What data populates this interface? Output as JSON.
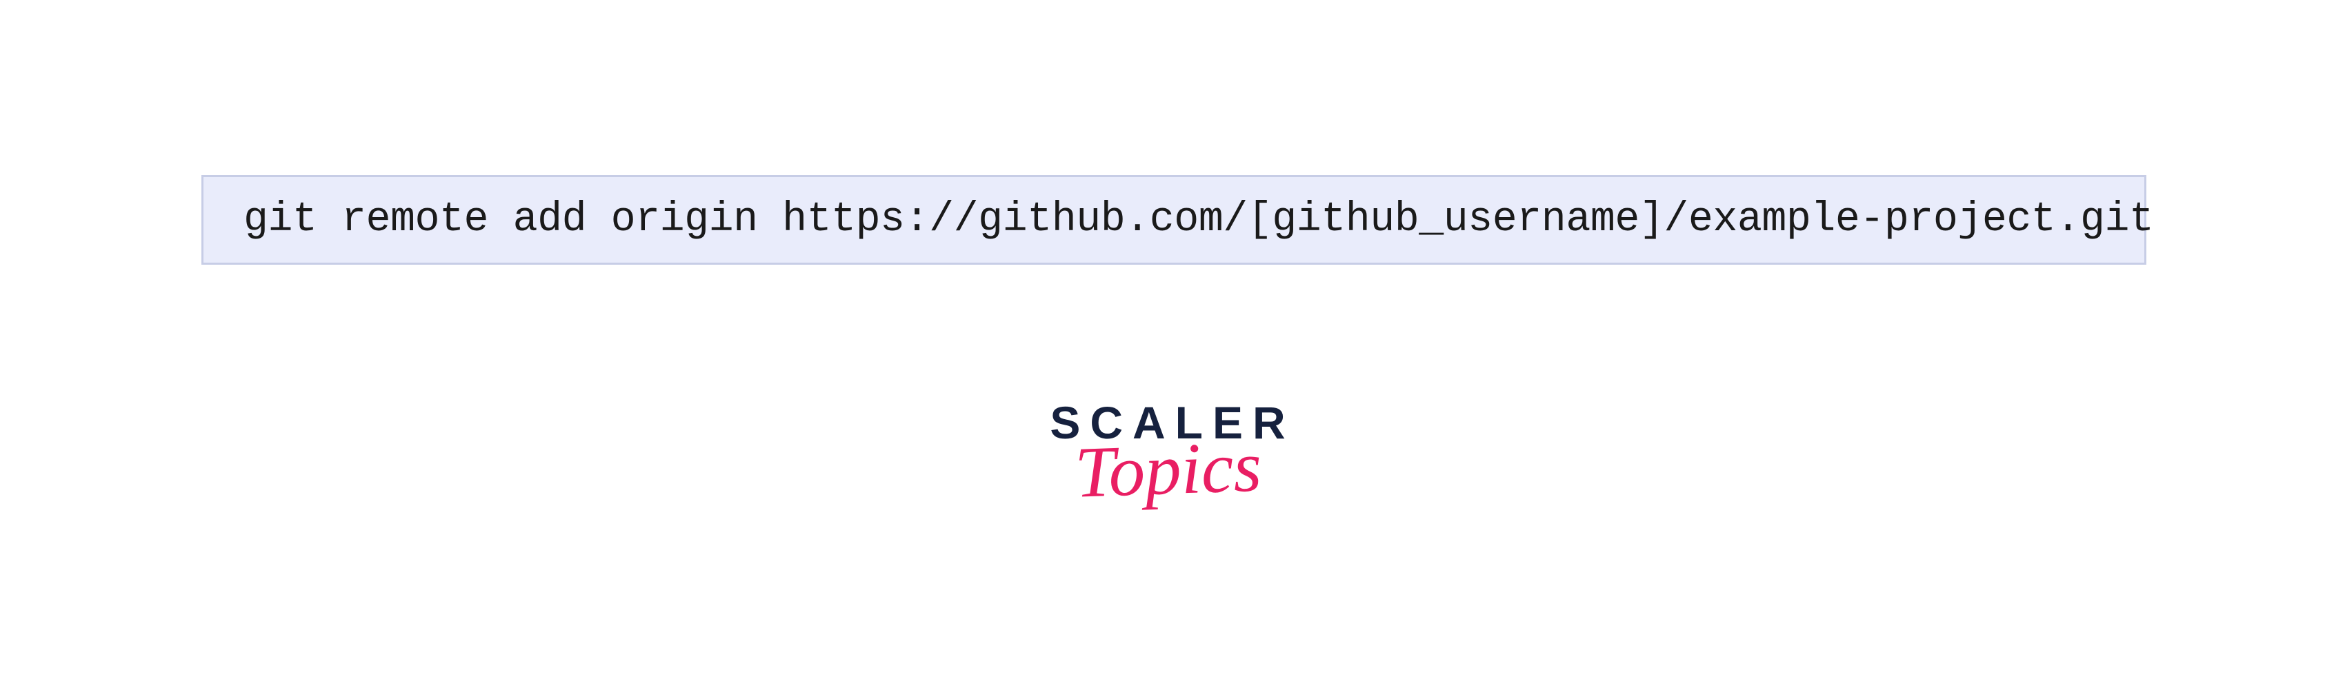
{
  "code_block": {
    "command": "git remote add origin https://github.com/[github_username]/example-project.git"
  },
  "logo": {
    "brand_name": "SCALER",
    "sub_name": "Topics"
  },
  "colors": {
    "code_bg": "#e9ecfb",
    "code_border": "#c7cde6",
    "code_text": "#1a1a1a",
    "brand_dark": "#16213e",
    "brand_pink": "#e91e63"
  }
}
